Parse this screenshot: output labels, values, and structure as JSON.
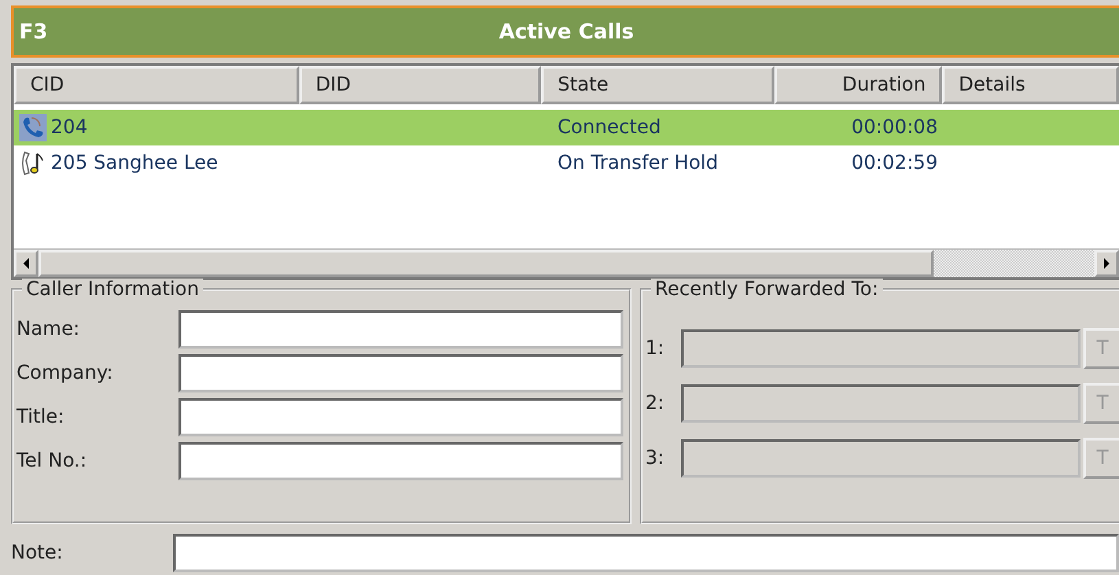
{
  "title_bar": {
    "key": "F3",
    "title": "Active Calls"
  },
  "table": {
    "columns": [
      "CID",
      "DID",
      "State",
      "Duration",
      "Details"
    ],
    "rows": [
      {
        "kind": "connected",
        "cid": "204",
        "did": "",
        "state": "Connected",
        "duration": "00:00:08",
        "selected": true
      },
      {
        "kind": "hold",
        "cid": "205 Sanghee Lee",
        "did": "",
        "state": "On Transfer Hold",
        "duration": "00:02:59",
        "selected": false
      }
    ]
  },
  "caller_information": {
    "title": "Caller Information",
    "fields": [
      {
        "label": "Name:"
      },
      {
        "label": "Company:"
      },
      {
        "label": "Title:"
      },
      {
        "label": "Tel No.:"
      }
    ]
  },
  "recently_forwarded": {
    "title": "Recently Forwarded To:",
    "entries": [
      {
        "label": "1:",
        "disabled": true,
        "button": "T"
      },
      {
        "label": "2:",
        "disabled": true,
        "button": "T"
      },
      {
        "label": "3:",
        "disabled": true,
        "button": "T"
      }
    ]
  },
  "note": {
    "label": "Note:"
  }
}
